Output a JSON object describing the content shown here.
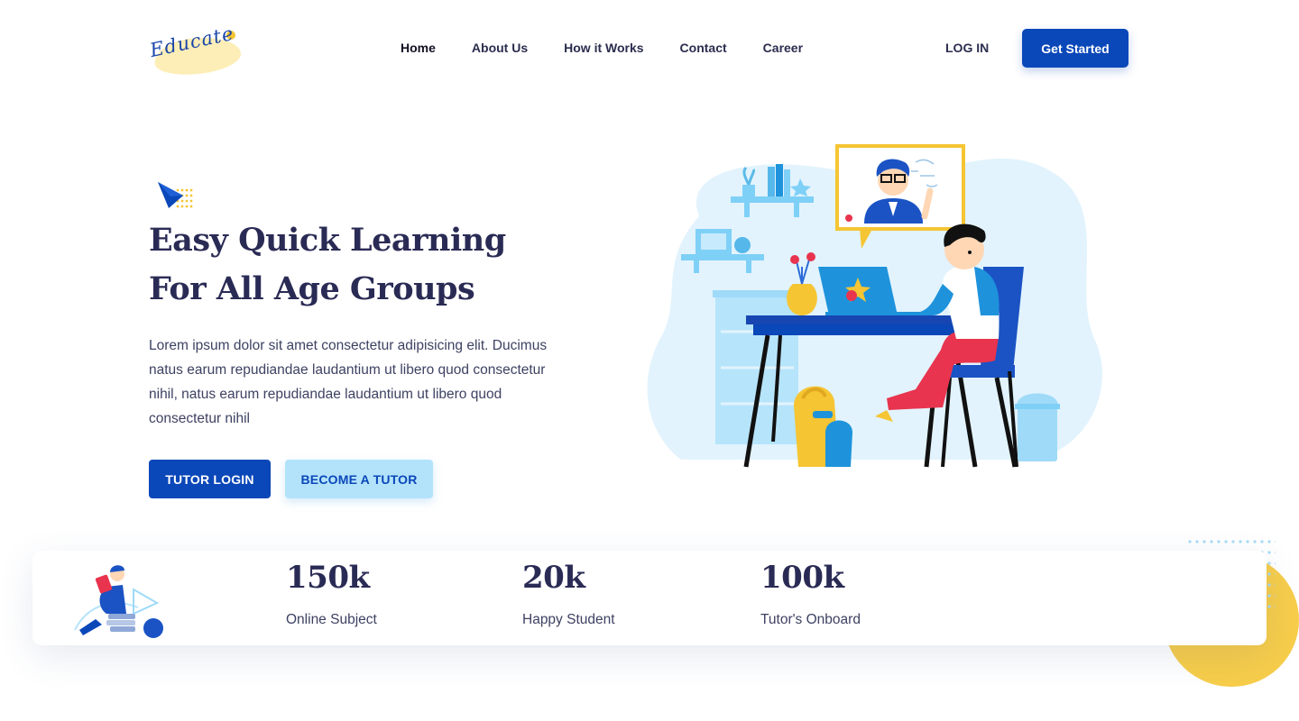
{
  "header": {
    "logo_text": "Educate",
    "nav": [
      {
        "label": "Home",
        "active": true
      },
      {
        "label": "About Us"
      },
      {
        "label": "How it Works"
      },
      {
        "label": "Contact"
      },
      {
        "label": "Career"
      }
    ],
    "login_label": "LOG IN",
    "cta_label": "Get Started"
  },
  "hero": {
    "title": "Easy Quick Learning For All Age Groups",
    "description": "Lorem ipsum dolor sit amet consectetur adipisicing elit. Ducimus natus earum repudiandae laudantium ut libero quod consectetur nihil, natus earum repudiandae laudantium ut libero quod consectetur nihil",
    "primary_button": "TUTOR LOGIN",
    "secondary_button": "BECOME A TUTOR",
    "illustration": "student-online-learning-illustration"
  },
  "stats": [
    {
      "number": "150k",
      "label": "Online Subject"
    },
    {
      "number": "20k",
      "label": "Happy Student"
    },
    {
      "number": "100k",
      "label": "Tutor's Onboard"
    }
  ],
  "colors": {
    "primary": "#0a47b8",
    "light_blue": "#b3e3fb",
    "accent_yellow": "#f7cd4a",
    "heading": "#2a2b55"
  }
}
